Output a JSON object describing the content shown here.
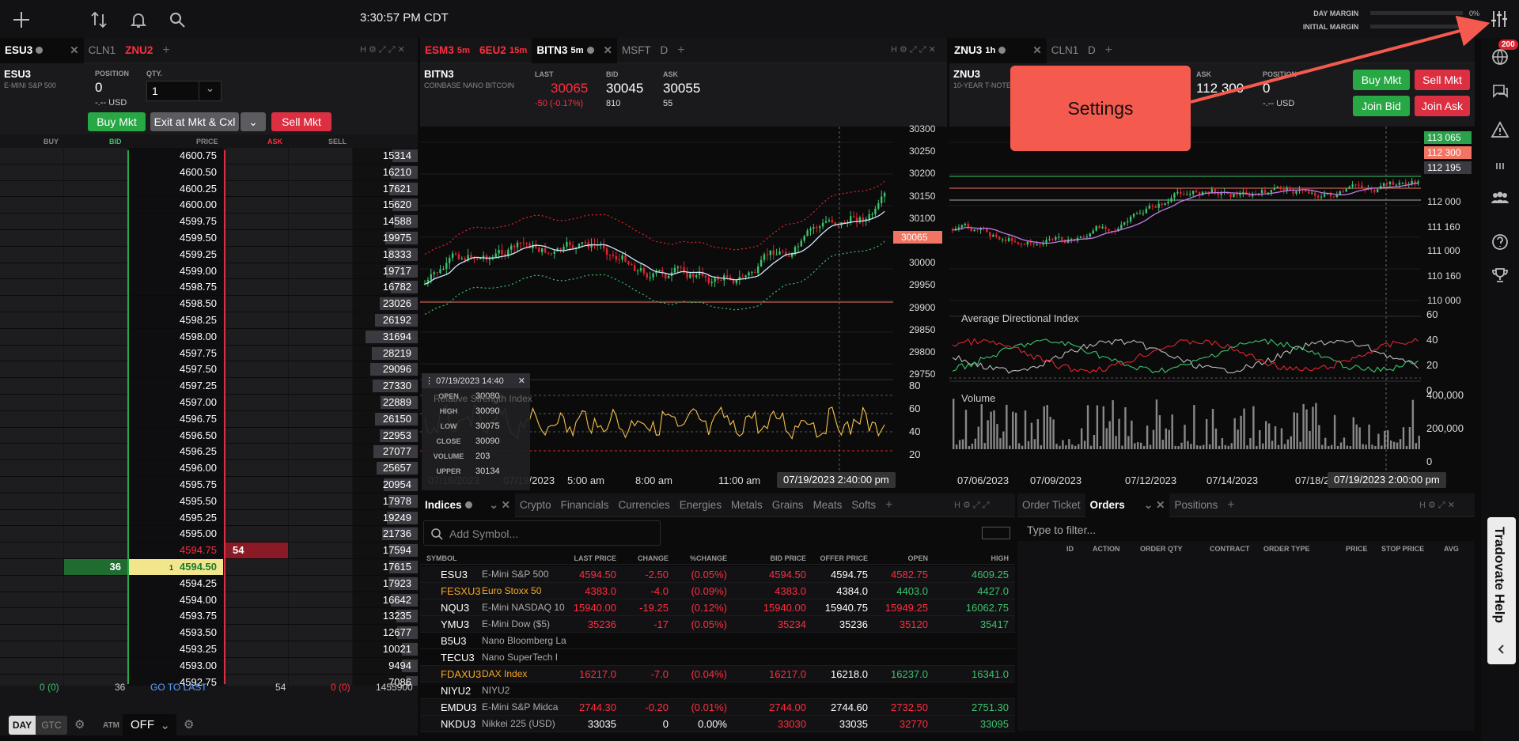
{
  "topbar": {
    "clock": "3:30:57 PM CDT",
    "day_margin_label": "DAY MARGIN",
    "day_margin_value": "0%",
    "initial_margin_label": "INITIAL MARGIN",
    "initial_margin_value": "0%"
  },
  "rail": {
    "badge": "200",
    "help_label": "Tradovate Help"
  },
  "popup": {
    "label": "Settings"
  },
  "dom_panel": {
    "tabs": [
      {
        "label": "ESU3",
        "active": true
      },
      {
        "label": "CLN1",
        "active": false
      },
      {
        "label": "ZNU2",
        "active": false,
        "alert": true
      }
    ],
    "symbol": "ESU3",
    "description": "E-MINI S&P 500",
    "position_label": "POSITION",
    "position_value": "0",
    "position_usd": "-.-- USD",
    "qty_label": "QTY.",
    "qty_value": "1",
    "buy_mkt": "Buy Mkt",
    "exit_cxl": "Exit at Mkt & Cxl",
    "sell_mkt": "Sell Mkt",
    "columns": [
      "BUY",
      "BID",
      "PRICE",
      "ASK",
      "SELL"
    ],
    "rows": [
      {
        "price": "4600.75",
        "vol": "15314",
        "vp": 0.39
      },
      {
        "price": "4600.50",
        "vol": "16210",
        "vp": 0.41
      },
      {
        "price": "4600.25",
        "vol": "17621",
        "vp": 0.44
      },
      {
        "price": "4600.00",
        "vol": "15620",
        "vp": 0.39
      },
      {
        "price": "4599.75",
        "vol": "14588",
        "vp": 0.37
      },
      {
        "price": "4599.50",
        "vol": "19975",
        "vp": 0.5
      },
      {
        "price": "4599.25",
        "vol": "18333",
        "vp": 0.46
      },
      {
        "price": "4599.00",
        "vol": "19717",
        "vp": 0.49
      },
      {
        "price": "4598.75",
        "vol": "16782",
        "vp": 0.42
      },
      {
        "price": "4598.50",
        "vol": "23026",
        "vp": 0.58
      },
      {
        "price": "4598.25",
        "vol": "26192",
        "vp": 0.66
      },
      {
        "price": "4598.00",
        "vol": "31694",
        "vp": 0.8
      },
      {
        "price": "4597.75",
        "vol": "28219",
        "vp": 0.71
      },
      {
        "price": "4597.50",
        "vol": "29096",
        "vp": 0.73
      },
      {
        "price": "4597.25",
        "vol": "27330",
        "vp": 0.69
      },
      {
        "price": "4597.00",
        "vol": "22889",
        "vp": 0.57
      },
      {
        "price": "4596.75",
        "vol": "26150",
        "vp": 0.66
      },
      {
        "price": "4596.50",
        "vol": "22953",
        "vp": 0.58
      },
      {
        "price": "4596.25",
        "vol": "27077",
        "vp": 0.68
      },
      {
        "price": "4596.00",
        "vol": "25657",
        "vp": 0.64
      },
      {
        "price": "4595.75",
        "vol": "20954",
        "vp": 0.53
      },
      {
        "price": "4595.50",
        "vol": "17978",
        "vp": 0.45
      },
      {
        "price": "4595.25",
        "vol": "19249",
        "vp": 0.48
      },
      {
        "price": "4595.00",
        "vol": "21736",
        "vp": 0.55
      },
      {
        "price": "4594.75",
        "vol": "17594",
        "vp": 0.44,
        "ask": "54",
        "ask_row": true
      },
      {
        "price": "4594.50",
        "vol": "17615",
        "vp": 0.44,
        "bid": "36",
        "last": true,
        "last_qty": "1"
      },
      {
        "price": "4594.25",
        "vol": "17923",
        "vp": 0.45
      },
      {
        "price": "4594.00",
        "vol": "16642",
        "vp": 0.42
      },
      {
        "price": "4593.75",
        "vol": "13235",
        "vp": 0.33
      },
      {
        "price": "4593.50",
        "vol": "12677",
        "vp": 0.32
      },
      {
        "price": "4593.25",
        "vol": "10021",
        "vp": 0.25
      },
      {
        "price": "4593.00",
        "vol": "9494",
        "vp": 0.24
      },
      {
        "price": "4592.75",
        "vol": "7086",
        "vp": 0.18
      }
    ],
    "foot": {
      "buy": "0 (0)",
      "bid": "36",
      "goto": "GO TO LAST",
      "ask": "54",
      "sell": "0 (0)",
      "vol": "1455900"
    },
    "day": "DAY",
    "gtc": "GTC",
    "atm_label": "ATM",
    "atm_value": "OFF"
  },
  "chart1": {
    "tabs": [
      {
        "label": "ESM3",
        "sup": "5m",
        "red": true
      },
      {
        "label": "6EU2",
        "sup": "15m",
        "red": true
      },
      {
        "label": "BITN3",
        "sup": "5m",
        "active": true
      },
      {
        "label": "MSFT",
        "sup": "D"
      }
    ],
    "symbol": "BITN3",
    "description": "COINBASE NANO BITCOIN",
    "last_label": "LAST",
    "last": "30065",
    "change": "-50 (-0.17%)",
    "bid_label": "BID",
    "bid": "30045",
    "bid_size": "810",
    "ask_label": "ASK",
    "ask": "30055",
    "ask_size": "55",
    "y_ticks": [
      "30300",
      "30250",
      "30200",
      "30150",
      "30100",
      "30050",
      "30000",
      "29950",
      "29900",
      "29850",
      "29800",
      "29750"
    ],
    "price_tag": "30065",
    "osc_ticks": [
      "80",
      "60",
      "40",
      "20"
    ],
    "osc_label": "Relative Strength Index",
    "x_ticks": [
      "07/18/2023",
      "07/19/2023",
      "5:00 am",
      "8:00 am",
      "11:00 am"
    ],
    "cursor_time": "07/19/2023 2:40:00 pm",
    "ohlc": {
      "time": "07/19/2023 14:40",
      "open_label": "OPEN",
      "open": "30080",
      "high_label": "HIGH",
      "high": "30090",
      "low_label": "LOW",
      "low": "30075",
      "close_label": "CLOSE",
      "close": "30090",
      "volume_label": "VOLUME",
      "volume": "203",
      "upper_label": "UPPER",
      "upper": "30134"
    }
  },
  "chart2": {
    "tabs": [
      {
        "label": "ZNU3",
        "sup": "1h",
        "active": true
      },
      {
        "label": "CLN1",
        "sup": "D"
      }
    ],
    "symbol": "ZNU3",
    "description": "10-YEAR T-NOTE",
    "ask_label": "ASK",
    "ask": "112 300",
    "position_label": "POSITION",
    "position": "0",
    "position_usd": "-.-- USD",
    "buy_mkt": "Buy Mkt",
    "sell_mkt": "Sell Mkt",
    "join_bid": "Join Bid",
    "join_ask": "Join Ask",
    "y_ticks": [
      "112 000",
      "111 160",
      "111 000",
      "110 160",
      "110 000"
    ],
    "tags": [
      "113 065",
      "112 300",
      "112 195"
    ],
    "adx_label": "Average Directional Index",
    "adx_ticks": [
      "60",
      "40",
      "20",
      "0"
    ],
    "vol_label": "Volume",
    "vol_ticks": [
      "400,000",
      "200,000",
      "0"
    ],
    "x_ticks": [
      "07/06/2023",
      "07/09/2023",
      "07/12/2023",
      "07/14/2023",
      "07/18/2"
    ],
    "cursor_time": "07/19/2023 2:00:00 pm"
  },
  "watchlist": {
    "tabs": [
      "Indices",
      "Crypto",
      "Financials",
      "Currencies",
      "Energies",
      "Metals",
      "Grains",
      "Meats",
      "Softs"
    ],
    "search_placeholder": "Add Symbol...",
    "columns": [
      "SYMBOL",
      "LAST PRICE",
      "CHANGE",
      "%CHANGE",
      "BID PRICE",
      "OFFER PRICE",
      "OPEN",
      "HIGH"
    ],
    "rows": [
      {
        "sym": "ESU3",
        "desc": "E-Mini S&P 500",
        "last": "4594.50",
        "chg": "-2.50",
        "pct": "(0.05%)",
        "bid": "4594.50",
        "offer": "4594.75",
        "open": "4582.75",
        "high": "4609.25",
        "dir": "down",
        "oc": "down",
        "hc": "up"
      },
      {
        "sym": "FESXU3",
        "desc": "Euro Stoxx 50",
        "last": "4383.0",
        "chg": "-4.0",
        "pct": "(0.09%)",
        "bid": "4383.0",
        "offer": "4384.0",
        "open": "4403.0",
        "high": "4427.0",
        "dir": "down",
        "oc": "up",
        "hc": "up",
        "orange": true
      },
      {
        "sym": "NQU3",
        "desc": "E-Mini NASDAQ 10",
        "last": "15940.00",
        "chg": "-19.25",
        "pct": "(0.12%)",
        "bid": "15940.00",
        "offer": "15940.75",
        "open": "15949.25",
        "high": "16062.75",
        "dir": "down",
        "oc": "down",
        "hc": "up"
      },
      {
        "sym": "YMU3",
        "desc": "E-Mini Dow ($5)",
        "last": "35236",
        "chg": "-17",
        "pct": "(0.05%)",
        "bid": "35234",
        "offer": "35236",
        "open": "35120",
        "high": "35417",
        "dir": "down",
        "oc": "down",
        "hc": "up"
      },
      {
        "sym": "B5U3",
        "desc": "Nano Bloomberg La",
        "last": "",
        "chg": "",
        "pct": "",
        "bid": "",
        "offer": "",
        "open": "",
        "high": "",
        "dir": "none"
      },
      {
        "sym": "TECU3",
        "desc": "Nano SuperTech I",
        "last": "",
        "chg": "",
        "pct": "",
        "bid": "",
        "offer": "",
        "open": "",
        "high": "",
        "dir": "none"
      },
      {
        "sym": "FDAXU3",
        "desc": "DAX Index",
        "last": "16217.0",
        "chg": "-7.0",
        "pct": "(0.04%)",
        "bid": "16217.0",
        "offer": "16218.0",
        "open": "16237.0",
        "high": "16341.0",
        "dir": "down",
        "oc": "up",
        "hc": "up",
        "orange": true
      },
      {
        "sym": "NIYU2",
        "desc": "NIYU2",
        "last": "",
        "chg": "",
        "pct": "",
        "bid": "",
        "offer": "",
        "open": "",
        "high": "",
        "dir": "none"
      },
      {
        "sym": "EMDU3",
        "desc": "E-Mini S&P Midca",
        "last": "2744.30",
        "chg": "-0.20",
        "pct": "(0.01%)",
        "bid": "2744.00",
        "offer": "2744.60",
        "open": "2732.50",
        "high": "2751.30",
        "dir": "down",
        "oc": "down",
        "hc": "up"
      },
      {
        "sym": "NKDU3",
        "desc": "Nikkei 225 (USD)",
        "last": "33035",
        "chg": "0",
        "pct": "0.00%",
        "bid": "33030",
        "offer": "33035",
        "open": "32770",
        "high": "33095",
        "dir": "flat",
        "oc": "down",
        "hc": "up"
      }
    ]
  },
  "orders": {
    "tabs": [
      "Order Ticket",
      "Orders",
      "Positions"
    ],
    "filter_placeholder": "Type to filter...",
    "columns": [
      "ID",
      "ACTION",
      "ORDER QTY",
      "CONTRACT",
      "ORDER TYPE",
      "PRICE",
      "STOP PRICE",
      "AVG"
    ]
  },
  "colors": {
    "bg": "#0b0b0c",
    "buy": "#28a745",
    "sell": "#dc2f41",
    "up": "#3cc36b",
    "down": "#ff2d3e",
    "accent": "#f55a4e"
  }
}
